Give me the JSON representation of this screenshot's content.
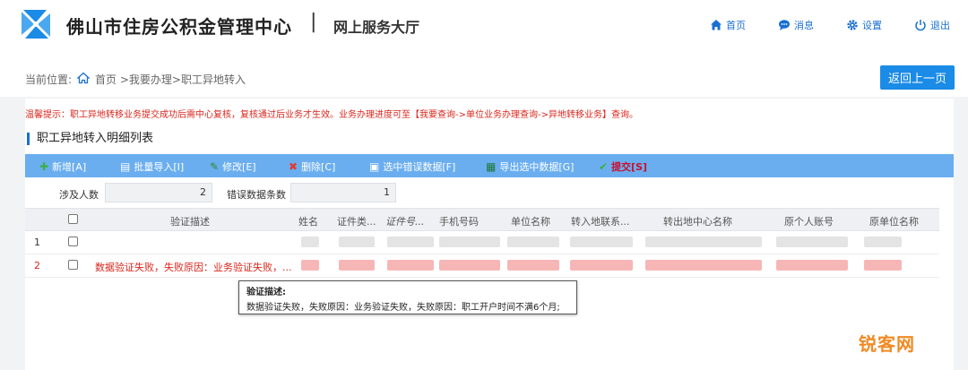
{
  "header": {
    "title": "佛山市住房公积金管理中心",
    "separator": "|",
    "subtitle": "网上服务大厅",
    "nav": {
      "home": "首页",
      "messages": "消息",
      "settings": "设置",
      "logout": "退出"
    }
  },
  "breadcrumb": {
    "label": "当前位置:",
    "path": "首页 >我要办理>职工异地转入"
  },
  "back_button": "返回上一页",
  "notice": "温馨提示：职工异地转移业务提交成功后需中心复核，复核通过后业务才生效。业务办理进度可至【我要查询->单位业务办理查询->异地转移业务】查询。",
  "section_title": "职工异地转入明细列表",
  "toolbar": {
    "add": "新增[A]",
    "batch_import": "批量导入[I]",
    "edit": "修改[E]",
    "delete": "删除[C]",
    "select_errors": "选中错误数据[F]",
    "export_selected": "导出选中数据[G]",
    "submit": "提交[S]"
  },
  "stats": {
    "people_label": "涉及人数",
    "people_value": "2",
    "errors_label": "错误数据条数",
    "errors_value": "1"
  },
  "table": {
    "columns": [
      "验证描述",
      "姓名",
      "证件类...",
      "证件号...",
      "手机号码",
      "单位名称",
      "转入地联系...",
      "转出地中心名称",
      "原个人账号",
      "原单位名称"
    ],
    "rows": [
      {
        "num": "1",
        "desc": ""
      },
      {
        "num": "2",
        "desc": "数据验证失败，失败原因：业务验证失败，..."
      }
    ]
  },
  "tooltip": {
    "title": "验证描述:",
    "body": "数据验证失败，失败原因：业务验证失败，失败原因：职工开户时间不满6个月;"
  },
  "watermark": "锐客网",
  "colors": {
    "primary": "#1a8be6",
    "toolbar": "#6aaef0",
    "error": "#d9261c",
    "watermark": "#f08a24"
  }
}
